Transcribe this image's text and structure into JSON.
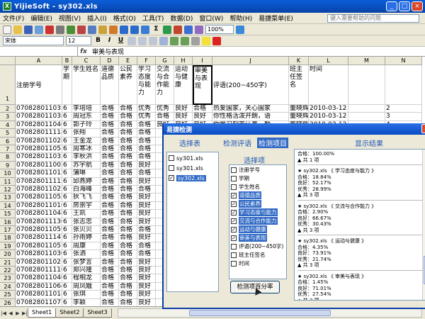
{
  "window": {
    "title": "YijieSoft - sy302.xls"
  },
  "menu": [
    "文件(F)",
    "编辑(E)",
    "视图(V)",
    "插入(I)",
    "格式(O)",
    "工具(T)",
    "数据(D)",
    "窗口(W)",
    "帮助(H)",
    "易捷菜单(E)"
  ],
  "help_placeholder": "键入需要帮助的问题",
  "toolbar": {
    "zoom": "100%",
    "font": "宋体",
    "size": "12"
  },
  "formula": {
    "namebox": "",
    "fx": "fx",
    "value": "审美与表现"
  },
  "columns": [
    "A",
    "B",
    "C",
    "D",
    "E",
    "F",
    "G",
    "H",
    "I",
    "J",
    "K",
    "L",
    "M",
    "N"
  ],
  "row1_headers": [
    "注册学号",
    "学期",
    "学生姓名",
    "道德品质",
    "公民素养",
    "学习态度与能力",
    "交流与合作能力",
    "运动与健康",
    "审美与表现",
    "评语(200~450字)",
    "班主任签名",
    "时间",
    "",
    ""
  ],
  "rows": [
    {
      "n": "2",
      "a": "0708280110338",
      "b": "6",
      "c": "李培培",
      "d": "合格",
      "e": "合格",
      "f": "优秀",
      "g": "优秀",
      "h": "良好",
      "i": "合格",
      "j": "热爱国家，关心国家",
      "k": "董晓辉",
      "l": "2010-03-12"
    },
    {
      "n": "3",
      "a": "0708280110387",
      "b": "6",
      "c": "周冠东",
      "d": "合格",
      "e": "合格",
      "f": "优秀",
      "g": "合格",
      "h": "良好",
      "i": "良好",
      "j": "你性格活泼开朗，语",
      "k": "董晓辉",
      "l": "2010-03-12"
    },
    {
      "n": "4",
      "a": "0708280110469",
      "b": "6",
      "c": "郭子玲",
      "d": "合格",
      "e": "合格",
      "f": "合格",
      "g": "良好",
      "h": "良好",
      "i": "良好",
      "j": "你学习刻苦认真，勤",
      "k": "董晓辉",
      "l": "2010-03-12"
    },
    {
      "n": "5",
      "a": "0708280111181",
      "b": "6",
      "c": "张翔",
      "d": "合格",
      "e": "合格",
      "f": "合格",
      "g": "",
      "h": "",
      "i": "",
      "j": "",
      "k": "",
      "l": ""
    },
    {
      "n": "6",
      "a": "0708280110283",
      "b": "6",
      "c": "王金龙",
      "d": "合格",
      "e": "合格",
      "f": "合格",
      "g": "",
      "h": "",
      "i": "",
      "j": "",
      "k": "",
      "l": ""
    },
    {
      "n": "7",
      "a": "0708280110535",
      "b": "6",
      "c": "周寒冰",
      "d": "合格",
      "e": "合格",
      "f": "合格",
      "g": "",
      "h": "",
      "i": "",
      "j": "",
      "k": "",
      "l": ""
    },
    {
      "n": "8",
      "a": "0708280110334",
      "b": "6",
      "c": "李秋洪",
      "d": "合格",
      "e": "合格",
      "f": "合格",
      "g": "",
      "h": "",
      "i": "",
      "j": "",
      "k": "",
      "l": ""
    },
    {
      "n": "9",
      "a": "0708280110025",
      "b": "6",
      "c": "苏宇航",
      "d": "合格",
      "e": "合格",
      "f": "良好",
      "g": "",
      "h": "",
      "i": "",
      "j": "",
      "k": "",
      "l": ""
    },
    {
      "n": "10",
      "a": "0708280110125",
      "b": "6",
      "c": "蒲琳",
      "d": "合格",
      "e": "合格",
      "f": "合格",
      "g": "",
      "h": "",
      "i": "",
      "j": "",
      "k": "",
      "l": ""
    },
    {
      "n": "11",
      "a": "0708280111122",
      "b": "6",
      "c": "邱燕婷",
      "d": "合格",
      "e": "合格",
      "f": "良好",
      "g": "",
      "h": "",
      "i": "",
      "j": "",
      "k": "",
      "l": ""
    },
    {
      "n": "12",
      "a": "0708280110228",
      "b": "6",
      "c": "白海峰",
      "d": "合格",
      "e": "合格",
      "f": "合格",
      "g": "",
      "h": "",
      "i": "",
      "j": "",
      "k": "",
      "l": ""
    },
    {
      "n": "13",
      "a": "0708280110526",
      "b": "6",
      "c": "狄飞飞",
      "d": "合格",
      "e": "合格",
      "f": "良好",
      "g": "",
      "h": "",
      "i": "",
      "j": "",
      "k": "",
      "l": ""
    },
    {
      "n": "14",
      "a": "0708280110163",
      "b": "6",
      "c": "房崇宇",
      "d": "合格",
      "e": "合格",
      "f": "良好",
      "g": "",
      "h": "",
      "i": "",
      "j": "",
      "k": "",
      "l": ""
    },
    {
      "n": "15",
      "a": "0708280110486",
      "b": "6",
      "c": "王凯",
      "d": "合格",
      "e": "合格",
      "f": "良好",
      "g": "",
      "h": "",
      "i": "",
      "j": "",
      "k": "",
      "l": ""
    },
    {
      "n": "16",
      "a": "0708280111304",
      "b": "6",
      "c": "张志忠",
      "d": "合格",
      "e": "合格",
      "f": "良好",
      "g": "",
      "h": "",
      "i": "",
      "j": "",
      "k": "",
      "l": ""
    },
    {
      "n": "17",
      "a": "0708280110594",
      "b": "6",
      "c": "张贝贝",
      "d": "合格",
      "e": "合格",
      "f": "合格",
      "g": "",
      "h": "",
      "i": "",
      "j": "",
      "k": "",
      "l": ""
    },
    {
      "n": "18",
      "a": "0708280111477",
      "b": "6",
      "c": "孙雨婷",
      "d": "合格",
      "e": "合格",
      "f": "良好",
      "g": "",
      "h": "",
      "i": "",
      "j": "",
      "k": "",
      "l": ""
    },
    {
      "n": "19",
      "a": "0708280110571",
      "b": "6",
      "c": "周康",
      "d": "合格",
      "e": "合格",
      "f": "合格",
      "g": "",
      "h": "",
      "i": "",
      "j": "",
      "k": "",
      "l": ""
    },
    {
      "n": "20",
      "a": "0708280110305",
      "b": "6",
      "c": "张洒",
      "d": "合格",
      "e": "合格",
      "f": "合格",
      "g": "",
      "h": "",
      "i": "",
      "j": "",
      "k": "",
      "l": ""
    },
    {
      "n": "21",
      "a": "0708280110218",
      "b": "6",
      "c": "张梦言",
      "d": "合格",
      "e": "合格",
      "f": "良好",
      "g": "",
      "h": "",
      "i": "",
      "j": "",
      "k": "",
      "l": ""
    },
    {
      "n": "22",
      "a": "0708280111100",
      "b": "6",
      "c": "郑兴隆",
      "d": "合格",
      "e": "合格",
      "f": "良好",
      "g": "",
      "h": "",
      "i": "",
      "j": "",
      "k": "",
      "l": ""
    },
    {
      "n": "23",
      "a": "0708280110406",
      "b": "6",
      "c": "程相龙",
      "d": "合格",
      "e": "合格",
      "f": "良好",
      "g": "",
      "h": "",
      "i": "",
      "j": "",
      "k": "",
      "l": ""
    },
    {
      "n": "24",
      "a": "0708280110641",
      "b": "6",
      "c": "周凤娥",
      "d": "合格",
      "e": "合格",
      "f": "良好",
      "g": "",
      "h": "",
      "i": "",
      "j": "",
      "k": "",
      "l": ""
    },
    {
      "n": "25",
      "a": "0708280110188",
      "b": "6",
      "c": "张琪",
      "d": "合格",
      "e": "合格",
      "f": "良好",
      "g": "",
      "h": "",
      "i": "",
      "j": "",
      "k": "",
      "l": ""
    },
    {
      "n": "26",
      "a": "0708280110774",
      "b": "6",
      "c": "李颖",
      "d": "合格",
      "e": "合格",
      "f": "良好",
      "g": "",
      "h": "",
      "i": "",
      "j": "",
      "k": "",
      "l": ""
    }
  ],
  "sheet_tabs": [
    "Sheet1",
    "Sheet2",
    "Sheet3"
  ],
  "dialog": {
    "title": "易捷检测",
    "close": "×",
    "header_left": "选择表",
    "tabs": [
      "检测评语",
      "检测项目"
    ],
    "results_label": "显示结果",
    "options_label": "选择项",
    "files": [
      {
        "name": "sy301.xls",
        "checked": false
      },
      {
        "name": "sy301.xls",
        "checked": false
      },
      {
        "name": "sy302.xls",
        "checked": true
      }
    ],
    "options": [
      {
        "label": "注册学号",
        "checked": false
      },
      {
        "label": "学期",
        "checked": false
      },
      {
        "label": "学生姓名",
        "checked": false
      },
      {
        "label": "道德品质",
        "checked": true
      },
      {
        "label": "公民素养",
        "checked": true
      },
      {
        "label": "学习态度与能力",
        "checked": true
      },
      {
        "label": "交流与合作能力",
        "checked": true
      },
      {
        "label": "运动与健康",
        "checked": true
      },
      {
        "label": "审美与表现",
        "checked": true
      },
      {
        "label": "评语(200~450字)",
        "checked": false
      },
      {
        "label": "班主任签名",
        "checked": false
      },
      {
        "label": "时间",
        "checked": false
      }
    ],
    "button": "检测项百分率",
    "results": [
      [
        "合格：100.00%",
        "▲ 共 1 项"
      ],
      [
        "★ sy302.xls 《 学习态度与能力 》",
        "合格：18.84%",
        "良好：52.17%",
        "优秀：28.99%",
        "▲ 共 3 项"
      ],
      [
        "★ sy302.xls 《 交流与合作能力 》",
        "合格：2.90%",
        "良好：66.67%",
        "优秀：30.43%",
        "▲ 共 3 项"
      ],
      [
        "★ sy302.xls 《 运动与健康 》",
        "合格：4.35%",
        "良好：73.91%",
        "优秀：21.74%",
        "▲ 共 3 项"
      ],
      [
        "★ sy302.xls 《 审美与表现 》",
        "合格：1.45%",
        "良好：71.01%",
        "优秀：27.54%",
        "▲ 共 3 项"
      ]
    ]
  }
}
